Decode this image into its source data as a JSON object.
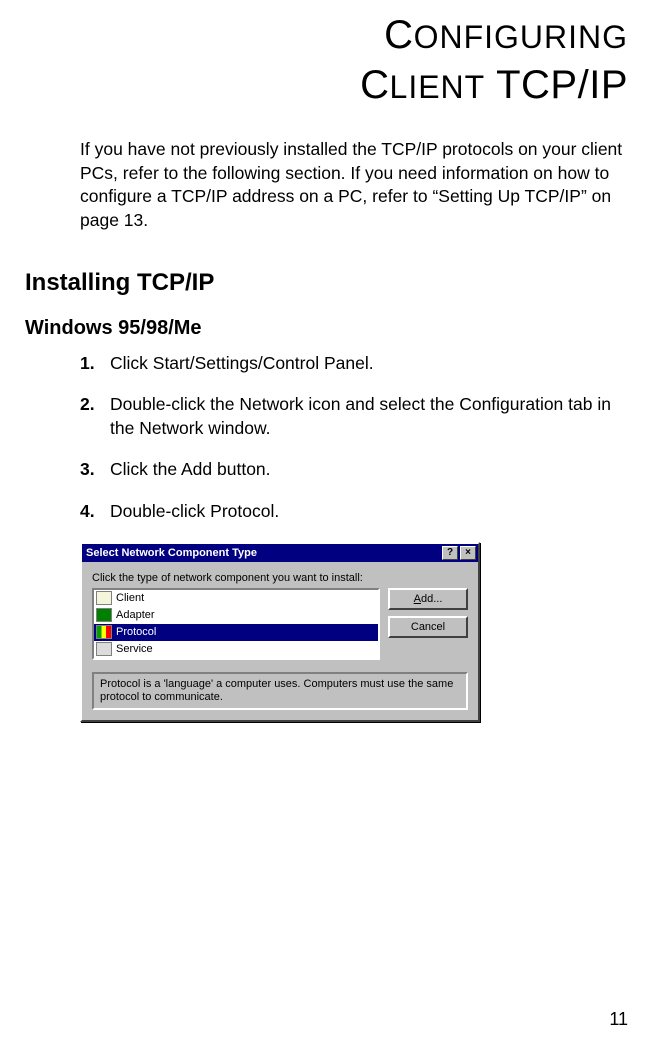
{
  "title_line1_cap": "C",
  "title_line1_rest": "ONFIGURING",
  "title_line2_cap1": "C",
  "title_line2_rest1": "LIENT",
  "title_line2_big": " TCP/IP",
  "intro": "If you have not previously installed the TCP/IP protocols on your client PCs, refer to the following section. If you need information on how to configure a TCP/IP address on a PC, refer to “Setting Up TCP/IP” on page 13.",
  "h2": "Installing TCP/IP",
  "h3": "Windows 95/98/Me",
  "steps": [
    "Click Start/Settings/Control Panel.",
    "Double-click the Network icon and select the Configuration tab in the Network window.",
    "Click the Add button.",
    "Double-click Protocol."
  ],
  "page_number": "11",
  "dialog": {
    "title": "Select Network Component Type",
    "help_symbol": "?",
    "close_symbol": "×",
    "label": "Click the type of network component you want to install:",
    "items": [
      "Client",
      "Adapter",
      "Protocol",
      "Service"
    ],
    "selected_index": 2,
    "add_button_prefix": "A",
    "add_button_rest": "dd...",
    "cancel_button": "Cancel",
    "description": "Protocol is a 'language' a computer uses. Computers must use the same protocol to communicate."
  }
}
